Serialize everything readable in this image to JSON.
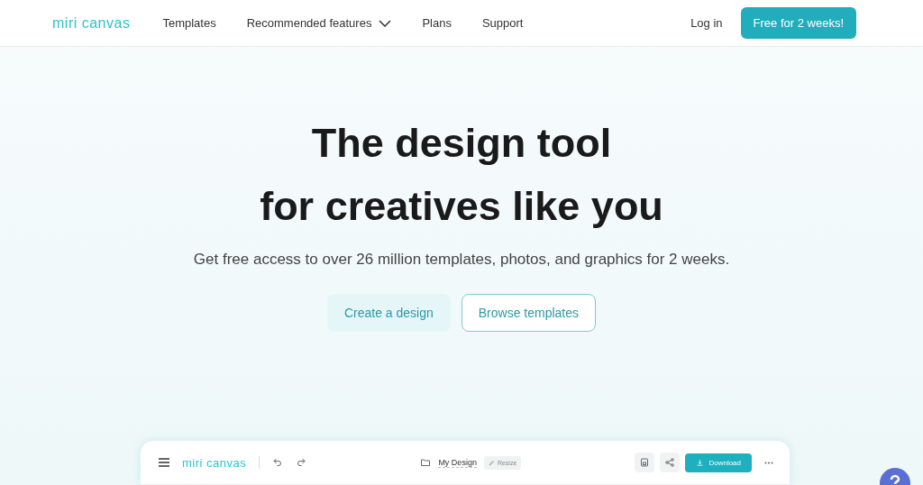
{
  "header": {
    "logo": "miri canvas",
    "nav": [
      {
        "label": "Templates",
        "kind": "link"
      },
      {
        "label": "Recommended features",
        "kind": "dropdown"
      },
      {
        "label": "Plans",
        "kind": "link"
      },
      {
        "label": "Support",
        "kind": "link"
      }
    ],
    "login": "Log in",
    "cta": "Free for 2 weeks!"
  },
  "hero": {
    "title_lines": [
      "The design tool",
      "for creatives like you"
    ],
    "subtitle": "Get free access to over 26 million templates, photos, and graphics for 2 weeks.",
    "buttons": [
      {
        "label": "Create a design",
        "kind": "soft"
      },
      {
        "label": "Browse templates",
        "kind": "outline"
      }
    ]
  },
  "editor": {
    "logo": "miri canvas",
    "design_name": "My Design",
    "resize": "Resize",
    "download": "Download"
  }
}
